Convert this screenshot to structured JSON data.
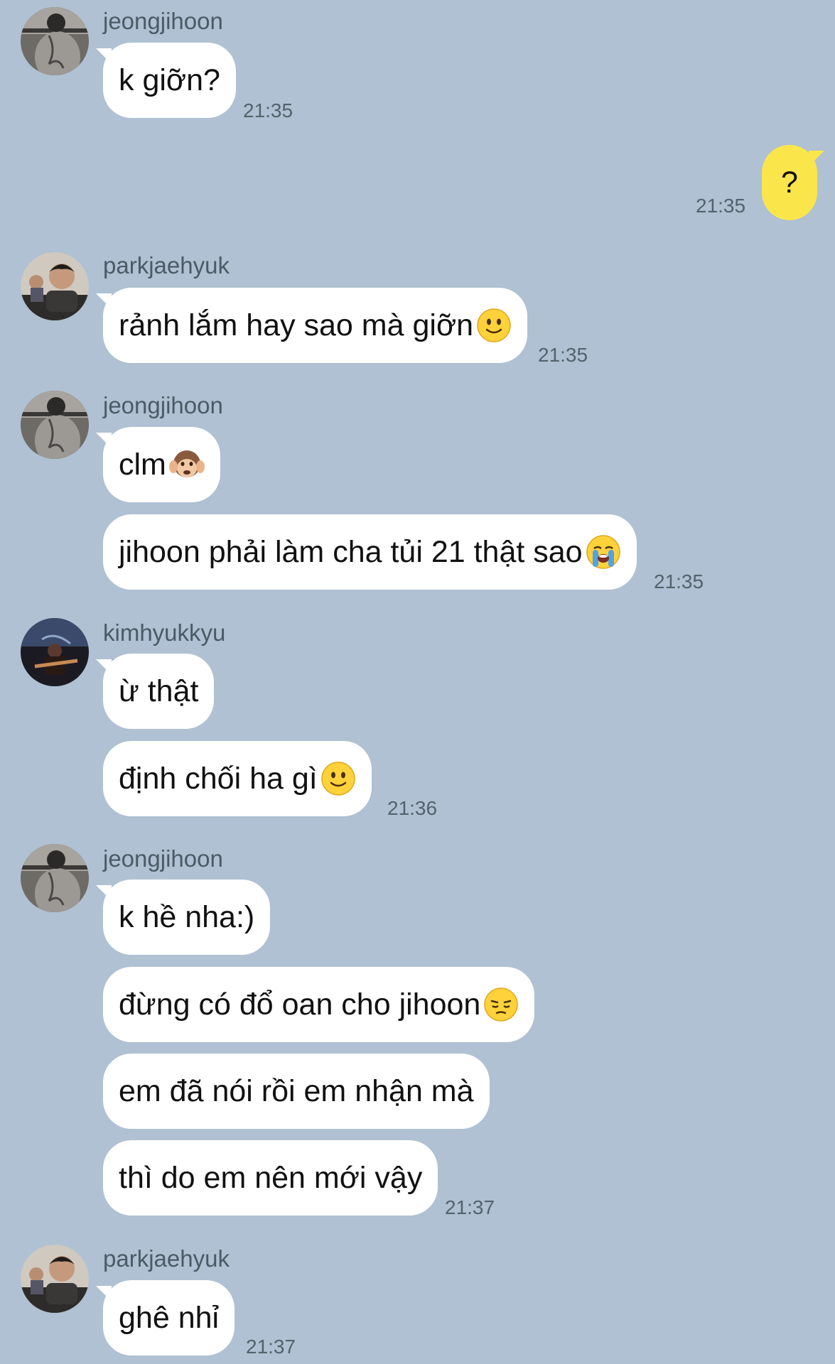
{
  "messages": [
    {
      "sender": "jeongjihoon",
      "bubbles": [
        "k giỡn?"
      ],
      "time": "21:35"
    },
    {
      "sender": "me",
      "bubbles": [
        "?"
      ],
      "time": "21:35"
    },
    {
      "sender": "parkjaehyuk",
      "bubbles": [
        "rảnh lắm hay sao mà giỡn"
      ],
      "time": "21:35"
    },
    {
      "sender": "jeongjihoon",
      "bubbles": [
        "clm",
        "jihoon phải làm cha tủi 21 thật sao"
      ],
      "time": "21:35"
    },
    {
      "sender": "kimhyukkyu",
      "bubbles": [
        "ừ thật",
        "định chối ha gì"
      ],
      "time": "21:36"
    },
    {
      "sender": "jeongjihoon",
      "bubbles": [
        "k hề nha:)",
        "đừng có đổ oan cho jihoon",
        "em đã nói rồi em nhận mà",
        "thì do em nên mới vậy"
      ],
      "time": "21:37"
    },
    {
      "sender": "parkjaehyuk",
      "bubbles": [
        "ghê nhỉ"
      ],
      "time": "21:37"
    }
  ],
  "icons": {
    "slight-smile": "slightly-smiling-face-emoji",
    "monkey": "hear-no-evil-monkey-emoji",
    "crying": "loudly-crying-face-emoji",
    "pensive": "pensive-face-emoji"
  },
  "colors": {
    "background": "#AFC1D2",
    "incoming_bubble": "#FFFFFF",
    "outgoing_bubble": "#FAE64B"
  }
}
